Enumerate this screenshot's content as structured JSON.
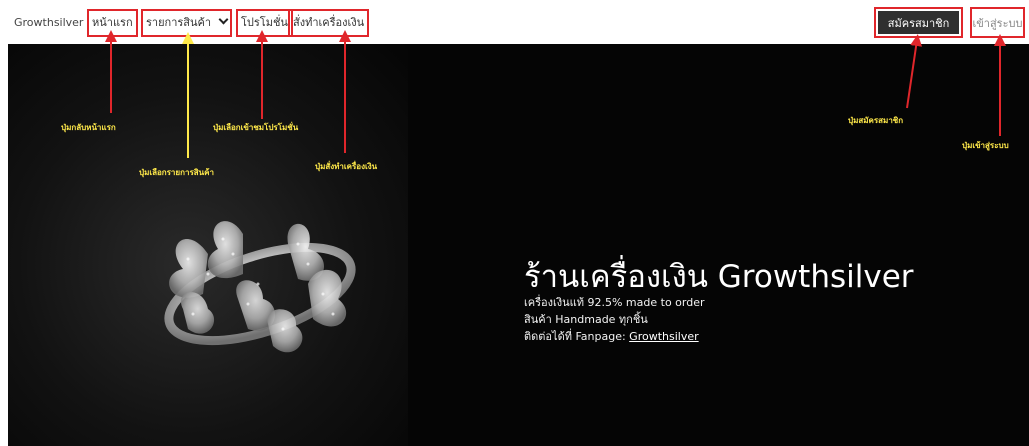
{
  "nav": {
    "brand": "Growthsilver",
    "home": "หน้าแรก",
    "products": "รายการสินค้า",
    "promotions": "โปรโมชั่น",
    "custom_order": "สั่งทำเครื่องเงิน",
    "register": "สมัครสมาชิก",
    "login": "เข้าสู่ระบบ"
  },
  "hero": {
    "title": "ร้านเครื่องเงิน Growthsilver",
    "line1": "เครื่องเงินแท้ 92.5% made to order",
    "line2": "สินค้า Handmade ทุกชิ้น",
    "line3_prefix": "ติดต่อได้ที่ Fanpage: ",
    "fanpage_link": "Growthsilver"
  },
  "annotations": {
    "home": "ปุ่มกลับหน้าแรก",
    "products": "ปุ่มเลือกรายการสินค้า",
    "promotions": "ปุ่มเลือกเข้าชมโปรโมชั่น",
    "custom_order": "ปุ่มสั่งทำเครื่องเงิน",
    "register": "ปุ่มสมัครสมาชิก",
    "login": "ปุ่มเข้าสู่ระบบ"
  },
  "colors": {
    "highlight_box": "#e0262b",
    "annotation_text": "#ffe94a",
    "hero_bg": "#050505",
    "register_bg": "#2f2f2f"
  }
}
